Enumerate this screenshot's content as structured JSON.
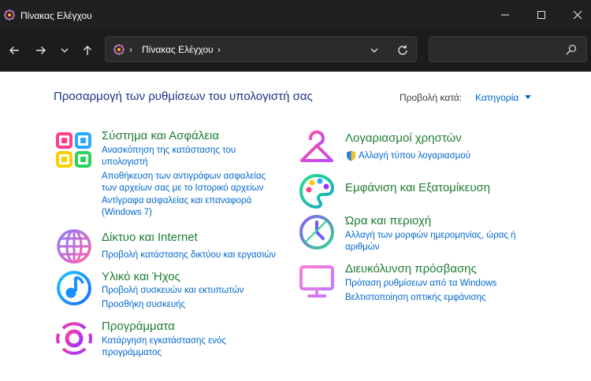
{
  "window": {
    "title": "Πίνακας Ελέγχου"
  },
  "address": {
    "path": "Πίνακας Ελέγχου"
  },
  "search": {
    "placeholder": ""
  },
  "header": {
    "title": "Προσαρμογή των ρυθμίσεων του υπολογιστή σας",
    "view_by_label": "Προβολή κατά:",
    "view_by_value": "Κατηγορία"
  },
  "categories": {
    "system": {
      "title": "Σύστημα και Ασφάλεια",
      "links": [
        [
          "Ανασκόπηση της κατάστασης του",
          "υπολογιστή"
        ],
        [
          "Αποθήκευση των αντιγράφων ασφαλείας",
          "των αρχείων σας με το Ιστορικό αρχείων"
        ],
        [
          "Αντίγραφα ασφαλείας και επαναφορά",
          "(Windows 7)"
        ]
      ]
    },
    "network": {
      "title": "Δίκτυο και Internet",
      "links": [
        "Προβολή κατάστασης δικτύου και εργασιών"
      ]
    },
    "hardware": {
      "title": "Υλικό και Ήχος",
      "links": [
        "Προβολή συσκευών και εκτυπωτών",
        "Προσθήκη συσκευής"
      ]
    },
    "programs": {
      "title": "Προγράμματα",
      "links": [
        [
          "Κατάργηση εγκατάστασης ενός",
          "προγράμματος"
        ]
      ]
    },
    "users": {
      "title": "Λογαριασμοί χρηστών",
      "links": [
        "Αλλαγή τύπου λογαριασμού"
      ]
    },
    "appearance": {
      "title": "Εμφάνιση και Εξατομίκευση",
      "links": []
    },
    "clock": {
      "title": "Ώρα και περιοχή",
      "links": [
        [
          "Αλλαγή των μορφών ημερομηνίας, ώρας ή",
          "αριθμών"
        ]
      ]
    },
    "ease": {
      "title": "Διευκόλυνση πρόσβασης",
      "links": [
        "Πρόταση ρυθμίσεων από τα Windows",
        "Βελτιστοποίηση οπτικής εμφάνισης"
      ]
    }
  },
  "colors": {
    "titlebar": "#202020",
    "navbar": "#1c1c1c",
    "page_title": "#1e3287",
    "category_title": "#1e7d32",
    "link": "#0066cc"
  }
}
